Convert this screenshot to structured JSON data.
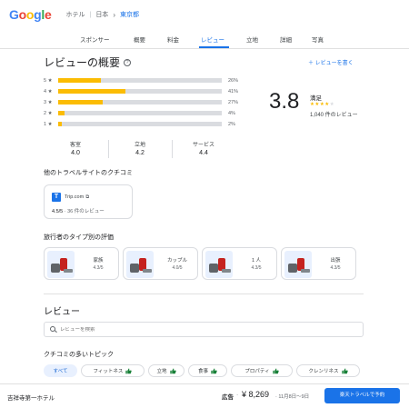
{
  "header": {
    "logo": [
      "G",
      "o",
      "o",
      "g",
      "l",
      "e"
    ],
    "breadcrumb": [
      "ホテル",
      "日本",
      "東京都"
    ]
  },
  "tabs": [
    "スポンサー",
    "概要",
    "料金",
    "レビュー",
    "立地",
    "詳細",
    "写真"
  ],
  "active_tab": "レビュー",
  "overview": {
    "title": "レビューの概要",
    "help_icon": "?",
    "write_review": "＋ レビューを書く",
    "distribution": [
      {
        "label": "5 ★",
        "percent": 26,
        "percent_text": "26%"
      },
      {
        "label": "4 ★",
        "percent": 41,
        "percent_text": "41%"
      },
      {
        "label": "3 ★",
        "percent": 27,
        "percent_text": "27%"
      },
      {
        "label": "2 ★",
        "percent": 4,
        "percent_text": "4%"
      },
      {
        "label": "1 ★",
        "percent": 2,
        "percent_text": "2%"
      }
    ],
    "score": "3.8",
    "score_label": "満足",
    "rating_stars": 3.8,
    "review_count": "1,040 件のレビュー",
    "subratings": [
      {
        "label": "客室",
        "value": "4.0"
      },
      {
        "label": "立地",
        "value": "4.2"
      },
      {
        "label": "サービス",
        "value": "4.4"
      }
    ]
  },
  "other_sites": {
    "title": "他のトラベルサイトのクチコミ",
    "site_logo": "T",
    "site_name": "Trip.com",
    "score": "4.5/5",
    "count": "· 36 件のレビュー"
  },
  "traveler_types": {
    "title": "旅行者のタイプ別の評価",
    "items": [
      {
        "name": "家族",
        "score": "4.3/5"
      },
      {
        "name": "カップル",
        "score": "4.0/5"
      },
      {
        "name": "1 人",
        "score": "4.3/5"
      },
      {
        "name": "出張",
        "score": "4.3/5"
      }
    ]
  },
  "reviews": {
    "title": "レビュー",
    "search_placeholder": "レビューを検索",
    "topics_title": "クチコミの多いトピック",
    "chips": [
      {
        "label": "すべて",
        "selected": true
      },
      {
        "label": "フィットネス",
        "selected": false
      },
      {
        "label": "立地",
        "selected": false
      },
      {
        "label": "食事",
        "selected": false
      },
      {
        "label": "プロパティ",
        "selected": false
      },
      {
        "label": "クレンリネス",
        "selected": false
      }
    ]
  },
  "footer": {
    "hotel_name": "吉祥寺第一ホテル",
    "ad_label": "広告",
    "separator": "·",
    "price": "¥ 8,269",
    "dates": "· 11月8日～9日",
    "book_button": "楽天トラベルで予約"
  },
  "colors": {
    "accent": "#1a73e8",
    "star": "#fbbc04"
  }
}
